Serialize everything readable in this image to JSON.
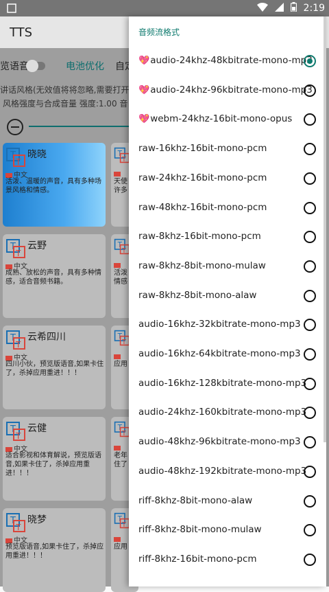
{
  "status": {
    "time": "2:19"
  },
  "app": {
    "title": "TTS"
  },
  "background": {
    "toggle_label": "览语音",
    "battery_label": "电池优化",
    "custom_label": "自定",
    "style_line": "讲话风格(无效值将将忽略,需要打开",
    "strength_line": "风格强度与合成音量   强度:1.00  音",
    "cards": [
      {
        "name": "晓晓",
        "lang": "中文",
        "desc": "活泼、温暖的声音，具有多种场景风格和情感。",
        "active": true
      },
      {
        "name": "云野",
        "lang": "中文",
        "desc": "成熟、放松的声音，具有多种情感，适合音频书籍。",
        "active": false
      },
      {
        "name": "云希四川",
        "lang": "中文",
        "desc": "四川小伙，预览版语音,如果卡住了，杀掉应用重进！！！",
        "active": false
      },
      {
        "name": "云健",
        "lang": "中文",
        "desc": "适合影视和体育解说，预览版语音,如果卡住了，杀掉应用重进！！！",
        "active": false
      },
      {
        "name": "晓梦",
        "lang": "中文",
        "desc": "预览版语音,如果卡住了，杀掉应用重进！！！",
        "active": false
      }
    ],
    "right_cards": [
      {
        "cut": "天使\n许多"
      },
      {
        "cut": "活泼\n情感"
      },
      {
        "cut": "应用"
      },
      {
        "cut": "老年\n住了"
      },
      {
        "cut": "应用"
      }
    ]
  },
  "dialog": {
    "title": "音频流格式",
    "selected_index": 0,
    "options": [
      {
        "label": "audio-24khz-48kbitrate-mono-mp3",
        "heart": true
      },
      {
        "label": "audio-24khz-96kbitrate-mono-mp3",
        "heart": true
      },
      {
        "label": "webm-24khz-16bit-mono-opus",
        "heart": true
      },
      {
        "label": "raw-16khz-16bit-mono-pcm",
        "heart": false
      },
      {
        "label": "raw-24khz-16bit-mono-pcm",
        "heart": false
      },
      {
        "label": "raw-48khz-16bit-mono-pcm",
        "heart": false
      },
      {
        "label": "raw-8khz-16bit-mono-pcm",
        "heart": false
      },
      {
        "label": "raw-8khz-8bit-mono-mulaw",
        "heart": false
      },
      {
        "label": "raw-8khz-8bit-mono-alaw",
        "heart": false
      },
      {
        "label": "audio-16khz-32kbitrate-mono-mp3",
        "heart": false
      },
      {
        "label": "audio-16khz-64kbitrate-mono-mp3",
        "heart": false
      },
      {
        "label": "audio-16khz-128kbitrate-mono-mp3",
        "heart": false
      },
      {
        "label": "audio-24khz-160kbitrate-mono-mp3",
        "heart": false
      },
      {
        "label": "audio-48khz-96kbitrate-mono-mp3",
        "heart": false
      },
      {
        "label": "audio-48khz-192kbitrate-mono-mp3",
        "heart": false
      },
      {
        "label": "riff-8khz-8bit-mono-alaw",
        "heart": false
      },
      {
        "label": "riff-8khz-8bit-mono-mulaw",
        "heart": false
      },
      {
        "label": "riff-8khz-16bit-mono-pcm",
        "heart": false
      }
    ]
  },
  "colors": {
    "accent": "#0e7a6e",
    "heart": "#e44b8d",
    "scrim": "#9e9e9e"
  },
  "icons": [
    "wifi-icon",
    "signal-icon",
    "battery-icon",
    "tts-voice-icon",
    "minus-icon",
    "heart-icon",
    "radio-icon"
  ]
}
